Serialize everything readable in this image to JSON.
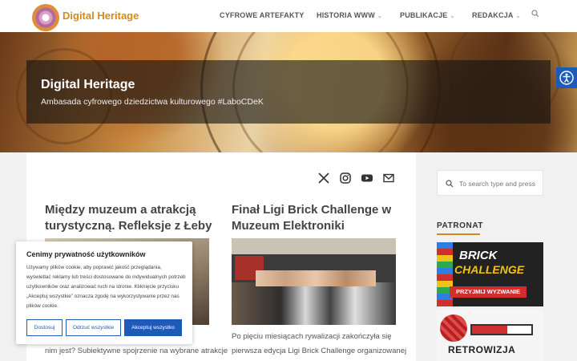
{
  "header": {
    "site_name": "Digital Heritage",
    "nav": [
      {
        "label": "CYFROWE ARTEFAKTY",
        "has_dropdown": false
      },
      {
        "label": "HISTORIA WWW",
        "has_dropdown": true
      },
      {
        "label": "PUBLIKACJE",
        "has_dropdown": true
      },
      {
        "label": "REDAKCJA",
        "has_dropdown": true
      }
    ]
  },
  "hero": {
    "title": "Digital Heritage",
    "subtitle": "Ambasada cyfrowego dziedzictwa kulturowego #LaboCDeK"
  },
  "social": [
    "x-icon",
    "instagram-icon",
    "youtube-icon",
    "mail-icon"
  ],
  "posts": [
    {
      "title_line1": "Między muzeum a atrakcją",
      "title_line2": "turystyczną. Refleksje z Łeby",
      "excerpt_line1": "nim jest? Subiektywne spojrzenie na wybrane atrakcje"
    },
    {
      "title_line1": "Finał Ligi Brick Challenge w",
      "title_line2": "Muzeum Elektroniki",
      "excerpt_line1": "Po pięciu miesiącach rywalizacji zakończyła się",
      "excerpt_line2": "pierwsza edycja Ligi Brick Challenge organizowanej"
    }
  ],
  "sidebar": {
    "search_placeholder": "To search type and press",
    "patronat_heading": "PATRONAT",
    "banner1_line1": "BRICK",
    "banner1_line2": "CHALLENGE",
    "banner1_tag": "PRZYJMIJ WYZWANIE",
    "banner2_text": "RETROWIZJA"
  },
  "cookie": {
    "title": "Cenimy prywatność użytkowników",
    "text": "Używamy plików cookie, aby poprawić jakość przeglądania, wyświetlać reklamy lub treści dostosowane do indywidualnych potrzeb użytkowników oraz analizować ruch na stronie. Kliknięcie przycisku „Akceptuj wszystkie” oznacza zgodę na wykorzystywanie przez nas plików cookie.",
    "btn_customize": "Dostosuj",
    "btn_reject": "Odrzuć wszystkie",
    "btn_accept": "Akceptuj wszystko"
  },
  "colors": {
    "brand": "#d48a1a",
    "accent_blue": "#1e5bb8"
  }
}
